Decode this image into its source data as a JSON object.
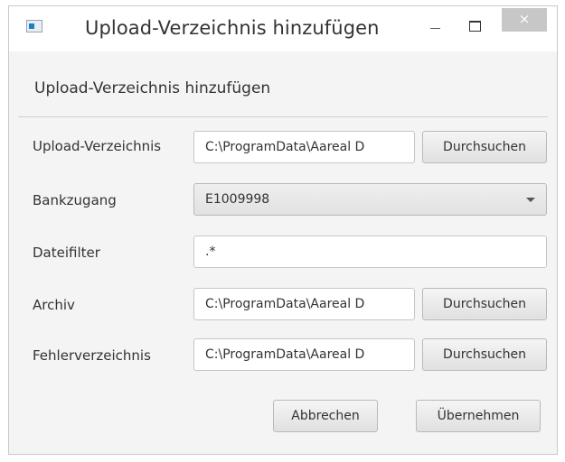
{
  "window": {
    "title": "Upload-Verzeichnis hinzufügen",
    "close_glyph": "×"
  },
  "header": {
    "title": "Upload-Verzeichnis hinzufügen"
  },
  "form": {
    "upload_dir": {
      "label": "Upload-Verzeichnis",
      "value": "C:\\ProgramData\\Aareal D",
      "browse_label": "Durchsuchen"
    },
    "bank_access": {
      "label": "Bankzugang",
      "value": "E1009998"
    },
    "file_filter": {
      "label": "Dateifilter",
      "value": ".*"
    },
    "archive": {
      "label": "Archiv",
      "value": "C:\\ProgramData\\Aareal D",
      "browse_label": "Durchsuchen"
    },
    "error_dir": {
      "label": "Fehlerverzeichnis",
      "value": "C:\\ProgramData\\Aareal D",
      "browse_label": "Durchsuchen"
    }
  },
  "actions": {
    "cancel_label": "Abbrechen",
    "apply_label": "Übernehmen"
  }
}
